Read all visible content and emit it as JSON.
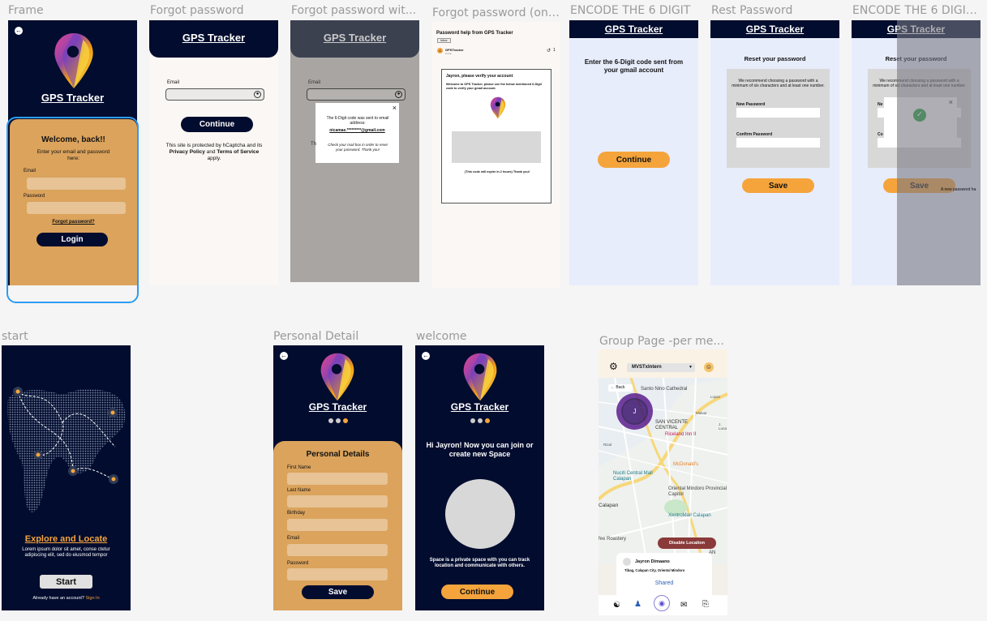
{
  "labels": {
    "frame": "Frame",
    "forgot": "Forgot password",
    "forgot_wit": "Forgot password wit...",
    "forgot_on": "Forgot password (on ...",
    "encode": "ENCODE THE 6 DIGIT",
    "reset": "Rest Password",
    "encode2": "ENCODE THE 6 DIGIT...",
    "start": "start",
    "personal": "Personal Detail",
    "welcome": "welcome",
    "group": "Group Page -per me..."
  },
  "app_title": "GPS Tracker",
  "login": {
    "welcome": "Welcome, back!!",
    "sub": "Enter your email and password here:",
    "email": "Email",
    "password": "Password",
    "forgot": "Forgot password?",
    "login_btn": "Login"
  },
  "forgot": {
    "email": "Email",
    "continue": "Continue",
    "legal_pre": "This site is protected by hCaptcha and its ",
    "privacy": "Privacy Policy",
    "and": " and ",
    "terms": "Terms of Service",
    "applies": " apply."
  },
  "forgot_modal": {
    "line1": "The 6-Digit code was sent to email address:",
    "email": "nicamae.*********@gmail.com",
    "line2": "Check your mail box in order to reset your password. Thank you!"
  },
  "gmail": {
    "subject": "Password help from GPS Tracker",
    "tag": "Inbox",
    "sender": "GPSTracker",
    "to": "to me",
    "reply": "1",
    "heading": "Jayron, please verify your account",
    "body": "Welcome to GPS Tracker, please use the below mentioned 6-Digit code to verify your gmail account.",
    "expire": "(This code will expire in 2 hours) Thank you!"
  },
  "encode": {
    "prompt": "Enter the 6-Digit code sent from your gmail account",
    "continue": "Continue"
  },
  "reset": {
    "title": "Reset your password",
    "desc": "We recommend choosing a password with a minimum of six characters and at least one number.",
    "new_pw": "New Password",
    "confirm_pw": "Confirm Password",
    "save": "Save"
  },
  "reset2": {
    "title": "Reset your password",
    "desc": "We recommend choosing a password with a minimum of six characters and at least one number.",
    "new_short": "Ne",
    "confirm_short": "Co",
    "save": "Save",
    "side_note": "A new password ha"
  },
  "start": {
    "heading": "Explore and Locate",
    "body": "Lorem ipsum dolor sit amet, conse ctetur adipiscing elit, sed do eiusmod tempor",
    "start_btn": "Start",
    "have_account": "Already have an account?",
    "sign_in": "Sign In"
  },
  "personal": {
    "title": "Personal Details",
    "first": "First Name",
    "last": "Last Name",
    "birthday": "Birthday",
    "email": "Email",
    "password": "Password",
    "save": "Save"
  },
  "welcome": {
    "greeting": "Hi Jayron! Now you can join or create new Space",
    "desc": "Space is a private space with you can track location and communicate with others.",
    "continue": "Continue"
  },
  "group": {
    "dropdown": "MVSTxIntern",
    "back": "Back",
    "avatar_letter": "J",
    "map_labels": {
      "santo_nino": "Santo Nino Cathedral",
      "lopez": "Lopez",
      "malvar": "Malvar",
      "san_vicente": "SAN VICENTE CENTRAL",
      "riceland": "Riceland Inn II",
      "mcdonalds": "McDonald's",
      "nuciti": "Nuciti Central Mall Calapan",
      "oriental": "Oriental Mindoro Provincial Capitol",
      "calapan": "Calapan",
      "xentro": "XentroMall Calapan",
      "roastery": "fee Roastery",
      "an": "AN",
      "rizal": "Rizal",
      "luna": "J. Luna"
    },
    "disable": "Disable Location",
    "user_name": "Jayron Dimaano",
    "user_addr": "Tibag, Calapan City, Oriental Mindoro",
    "shared": "Shared"
  },
  "colors": {
    "navy": "#020c2e",
    "orange": "#f5a43c",
    "tan": "#dba35c",
    "light_blue": "#e8edfc",
    "gray_overlay": "#a8a5a3",
    "selection": "#2d9cf0"
  }
}
